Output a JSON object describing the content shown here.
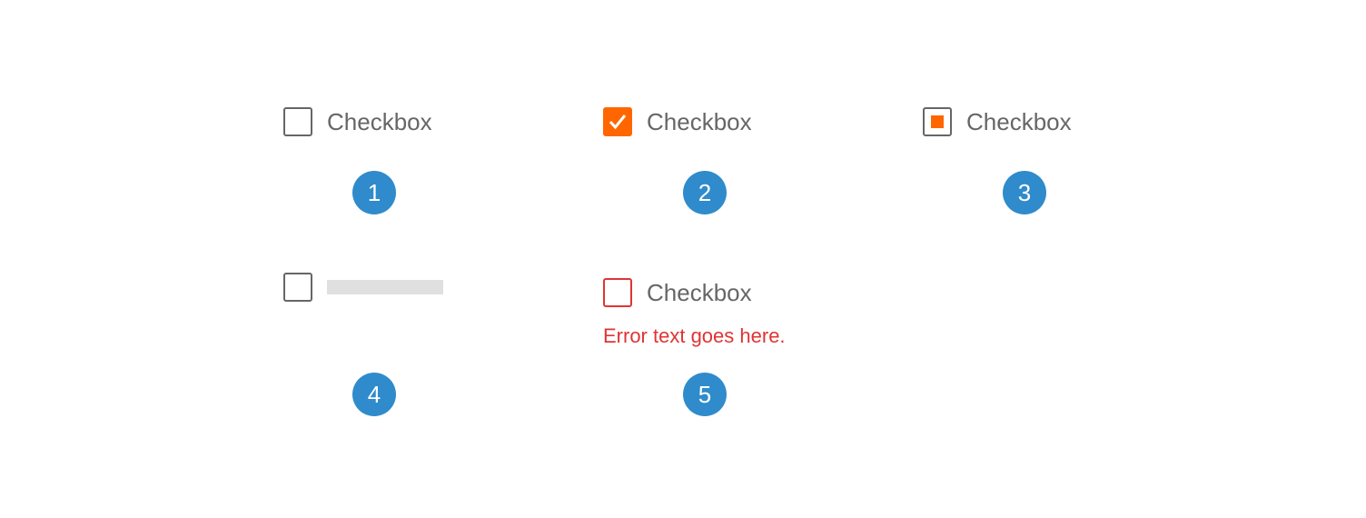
{
  "checkboxes": [
    {
      "label": "Checkbox",
      "state": "unchecked"
    },
    {
      "label": "Checkbox",
      "state": "checked"
    },
    {
      "label": "Checkbox",
      "state": "indeterminate"
    },
    {
      "label": "",
      "state": "loading"
    },
    {
      "label": "Checkbox",
      "state": "error",
      "error_text": "Error text goes here."
    }
  ],
  "badges": [
    "1",
    "2",
    "3",
    "4",
    "5"
  ],
  "colors": {
    "accent": "#ff6600",
    "error": "#e03434",
    "badge": "#2f8bcb",
    "text": "#666666"
  }
}
